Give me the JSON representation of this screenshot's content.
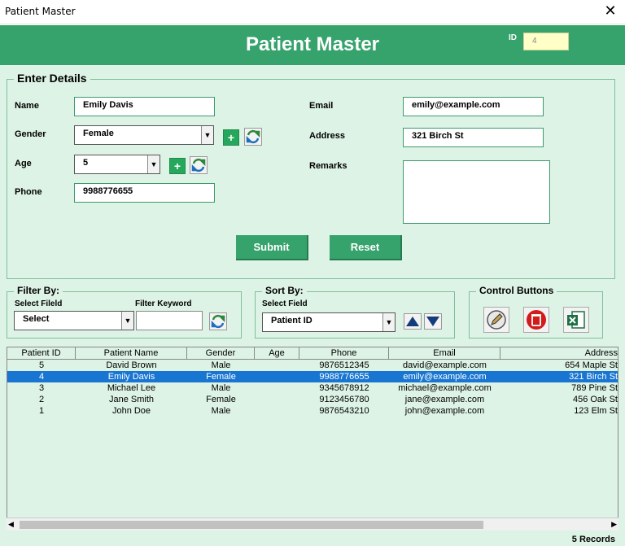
{
  "window": {
    "title": "Patient Master",
    "close_glyph": "✕"
  },
  "header": {
    "title": "Patient Master",
    "id_label": "ID",
    "id_value": "4"
  },
  "details": {
    "legend": "Enter Details",
    "name_label": "Name",
    "name_value": "Emily Davis",
    "gender_label": "Gender",
    "gender_value": "Female",
    "age_label": "Age",
    "age_value": "5",
    "phone_label": "Phone",
    "phone_value": "9988776655",
    "email_label": "Email",
    "email_value": "emily@example.com",
    "address_label": "Address",
    "address_value": "321 Birch St",
    "remarks_label": "Remarks",
    "remarks_value": "",
    "submit_label": "Submit",
    "reset_label": "Reset"
  },
  "filter": {
    "legend": "Filter By:",
    "field_label": "Select Fileld",
    "field_value": "Select",
    "keyword_label": "Filter Keyword",
    "keyword_value": ""
  },
  "sort": {
    "legend": "Sort By:",
    "field_label": "Select Field",
    "field_value": "Patient ID"
  },
  "controls": {
    "legend": "Control Buttons",
    "icons": [
      "edit-icon",
      "delete-icon",
      "excel-icon"
    ]
  },
  "grid": {
    "columns": [
      "Patient ID",
      "Patient Name",
      "Gender",
      "Age",
      "Phone",
      "Email",
      "Address"
    ],
    "rows": [
      [
        "5",
        "David Brown",
        "Male",
        "",
        "9876512345",
        "david@example.com",
        "654 Maple St"
      ],
      [
        "4",
        "Emily Davis",
        "Female",
        "",
        "9988776655",
        "emily@example.com",
        "321 Birch St"
      ],
      [
        "3",
        "Michael Lee",
        "Male",
        "",
        "9345678912",
        "michael@example.com",
        "789 Pine St"
      ],
      [
        "2",
        "Jane Smith",
        "Female",
        "",
        "9123456780",
        "jane@example.com",
        "456 Oak St"
      ],
      [
        "1",
        "John Doe",
        "Male",
        "",
        "9876543210",
        "john@example.com",
        "123 Elm St"
      ]
    ],
    "selected_row": 1
  },
  "status": {
    "records": "5 Records"
  },
  "colors": {
    "header": "#36a26c",
    "form_bg": "#ddf3e6",
    "selection": "#1875d1"
  }
}
